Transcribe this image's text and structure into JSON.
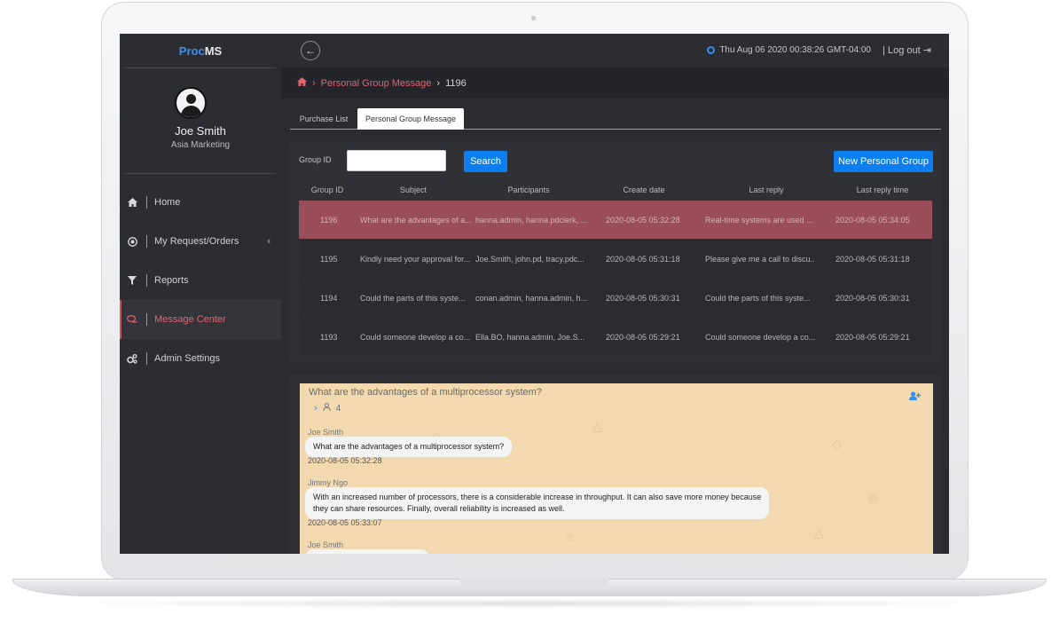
{
  "app": {
    "brand_part1": "Proc",
    "brand_part2": "MS"
  },
  "user": {
    "name": "Joe Smith",
    "role": "Asia Marketing"
  },
  "sidebar": {
    "items": [
      {
        "label": "Home",
        "icon": "home-icon"
      },
      {
        "label": "My Request/Orders",
        "icon": "target-icon"
      },
      {
        "label": "Reports",
        "icon": "filter-icon"
      },
      {
        "label": "Message Center",
        "icon": "chat-icon"
      },
      {
        "label": "Admin Settings",
        "icon": "cogs-icon"
      }
    ],
    "active": "Message Center"
  },
  "topbar": {
    "datetime": "Thu Aug 06 2020 00:38:26 GMT-04:00",
    "logout": "Log out"
  },
  "breadcrumb": {
    "section": "Personal Group Message",
    "current": "1196"
  },
  "tabs": [
    {
      "label": "Purchase List"
    },
    {
      "label": "Personal Group Message"
    }
  ],
  "search": {
    "label": "Group ID",
    "button": "Search",
    "new_button": "New Personal Group",
    "value": ""
  },
  "table": {
    "headers": [
      "Group ID",
      "Subject",
      "Participants",
      "Create date",
      "Last reply",
      "Last reply time"
    ],
    "rows": [
      [
        "1196",
        "What are the advantages of a...",
        "hanna.admin, hanna.pdclerk, ...",
        "2020-08-05 05:32:28",
        "Real-time systems are used ...",
        "2020-08-05 05:34:05"
      ],
      [
        "1195",
        "Kindly need your approval for...",
        "Joe.Smith, john.pd, tracy.pdc...",
        "2020-08-05 05:31:18",
        "Please give me a call to discu...",
        "2020-08-05 05:31:18"
      ],
      [
        "1194",
        "Could the parts of this syste...",
        "conan.admin, hanna.admin, h...",
        "2020-08-05 05:30:31",
        "Could the parts of this syste...",
        "2020-08-05 05:30:31"
      ],
      [
        "1193",
        "Could someone develop a co...",
        "Ella.BO, hanna.admin, Joe.S...",
        "2020-08-05 05:29:21",
        "Could someone develop a co...",
        "2020-08-05 05:29:21"
      ]
    ]
  },
  "chat": {
    "title": "What are the advantages of a multiprocessor system?",
    "participants": "4",
    "messages": [
      {
        "sender": "Joe Smith",
        "text": "What are the advantages of a multiprocessor system?",
        "time": "2020-08-05 05:32:28"
      },
      {
        "sender": "Jimmy Ngo",
        "line1": "With an increased number of processors, there is a considerable increase in throughput. It can also save more money because",
        "line2": "they can share resources. Finally, overall reliability is increased as well.",
        "time": "2020-08-05 05:33:07"
      },
      {
        "sender": "Joe Smith"
      }
    ]
  },
  "colors": {
    "accent": "#0d7ef0",
    "active": "#e8606d",
    "selected_row": "#9a4f58",
    "chat_bg": "#f3d9af"
  }
}
